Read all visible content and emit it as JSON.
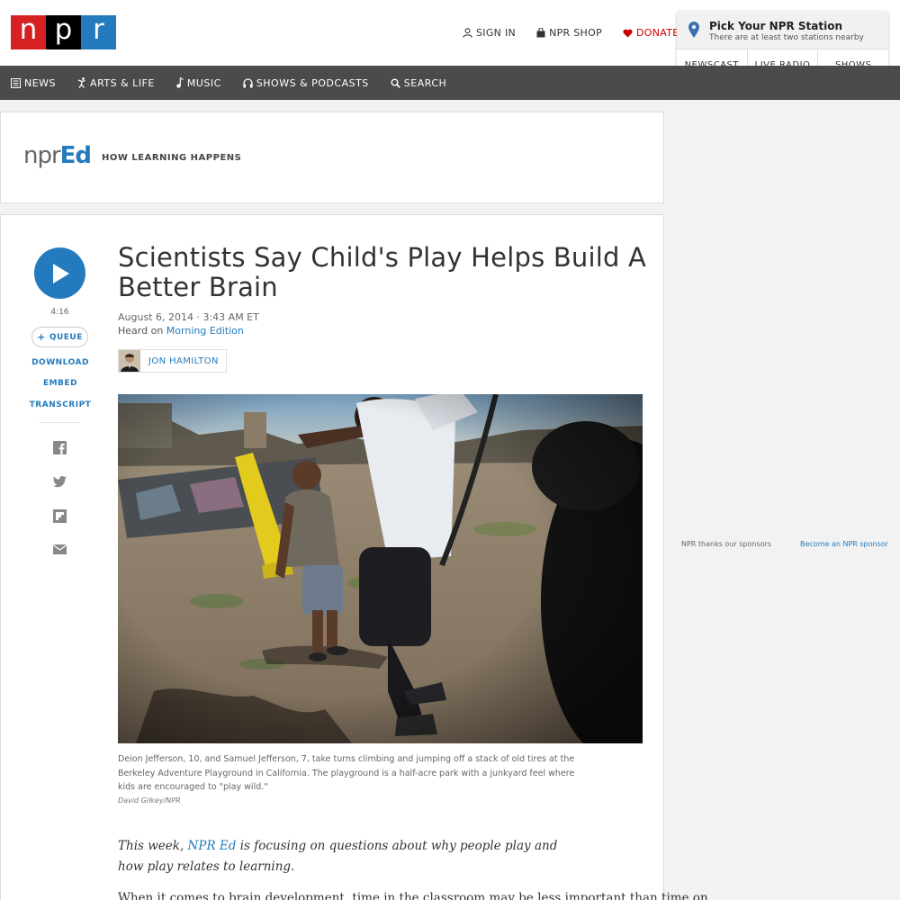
{
  "header": {
    "logo": {
      "l1": "n",
      "l2": "p",
      "l3": "r"
    },
    "links": {
      "sign_in": "SIGN IN",
      "shop": "NPR SHOP",
      "donate": "DONATE"
    },
    "station": {
      "title": "Pick Your NPR Station",
      "subtitle": "There are at least two stations nearby",
      "tabs": [
        "NEWSCAST",
        "LIVE RADIO",
        "SHOWS"
      ]
    }
  },
  "nav": {
    "items": [
      "NEWS",
      "ARTS & LIFE",
      "MUSIC",
      "SHOWS & PODCASTS",
      "SEARCH"
    ]
  },
  "ed_banner": {
    "logo_npr": "npr",
    "logo_ed": "Ed",
    "tagline": "HOW LEARNING HAPPENS"
  },
  "article": {
    "duration": "4:16",
    "queue_label": "QUEUE",
    "side_links": [
      "DOWNLOAD",
      "EMBED",
      "TRANSCRIPT"
    ],
    "share_icons": [
      "facebook-icon",
      "twitter-icon",
      "flipboard-icon",
      "email-icon"
    ],
    "title": "Scientists Say Child's Play Helps Build A Better Brain",
    "date": "August 6, 2014 · 3:43 AM ET",
    "heard_prefix": "Heard on ",
    "heard_show": "Morning Edition",
    "author": "JON HAMILTON",
    "caption": "Deion Jefferson, 10, and Samuel Jefferson, 7, take turns climbing and jumping off a stack of old tires at the Berkeley Adventure Playground in California. The playground is a half-acre park with a junkyard feel where kids are encouraged to \"play wild.\"",
    "credit": "David Gilkey/NPR",
    "body1_prefix": "This week, ",
    "body1_link": "NPR Ed",
    "body1_suffix": " is focusing on questions about why people play and how play relates to learning.",
    "body2": "When it comes to brain development, time in the classroom may be less important than time on"
  },
  "sidebar": {
    "sponsor_note": "NPR thanks our sponsors",
    "sponsor_link": "Become an NPR sponsor"
  },
  "colors": {
    "npr_red": "#d62021",
    "npr_blue": "#237bbd",
    "nav_bg": "#4b4b4b",
    "donate": "#cc0000"
  }
}
